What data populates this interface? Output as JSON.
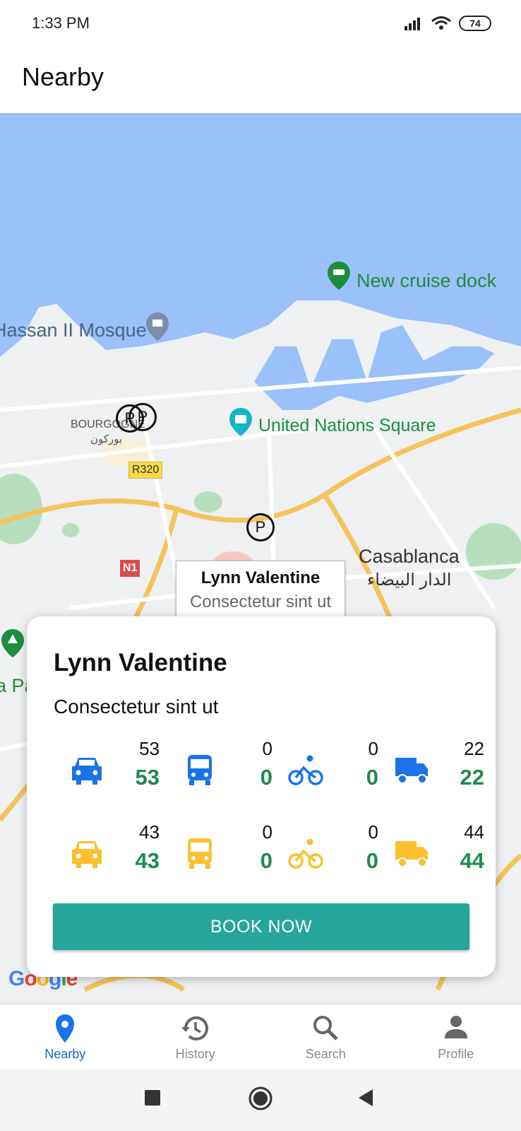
{
  "status_bar": {
    "time": "1:33 PM",
    "battery": "74"
  },
  "app_bar": {
    "title": "Nearby"
  },
  "map": {
    "labels": {
      "cruise_dock": "New cruise dock",
      "mosque": "Hassan II Mosque",
      "un_square": "United Nations Square",
      "bourgogne": "BOURGOGNE",
      "bourgogne_ar": "بوركون",
      "road_r320": "R320",
      "road_n1": "N1",
      "casablanca": "Casablanca",
      "casablanca_ar": "الدار البيضاء",
      "park_partial": "a Pa",
      "google": "Google"
    },
    "marker_symbol": "P",
    "info_window": {
      "title": "Lynn Valentine",
      "subtitle": "Consectetur sint ut"
    }
  },
  "card": {
    "name": "Lynn Valentine",
    "subtitle": "Consectetur sint ut",
    "rows": [
      {
        "color": "#1a73e8",
        "items": [
          {
            "icon": "car-icon",
            "total": "53",
            "available": "53"
          },
          {
            "icon": "bus-icon",
            "total": "0",
            "available": "0"
          },
          {
            "icon": "bike-icon",
            "total": "0",
            "available": "0"
          },
          {
            "icon": "truck-icon",
            "total": "22",
            "available": "22"
          }
        ]
      },
      {
        "color": "#fbc02d",
        "items": [
          {
            "icon": "car-icon",
            "total": "43",
            "available": "43"
          },
          {
            "icon": "bus-icon",
            "total": "0",
            "available": "0"
          },
          {
            "icon": "bike-icon",
            "total": "0",
            "available": "0"
          },
          {
            "icon": "truck-icon",
            "total": "44",
            "available": "44"
          }
        ]
      }
    ],
    "book_label": "BOOK NOW"
  },
  "bottom_nav": {
    "items": [
      {
        "label": "Nearby",
        "icon": "location-pin-icon",
        "active": true
      },
      {
        "label": "History",
        "icon": "history-icon",
        "active": false
      },
      {
        "label": "Search",
        "icon": "search-icon",
        "active": false
      },
      {
        "label": "Profile",
        "icon": "person-icon",
        "active": false
      }
    ]
  },
  "colors": {
    "accent": "#26a69a",
    "active_nav": "#1565c0",
    "count_green": "#1e8a4c",
    "water": "#9bc1fa"
  }
}
